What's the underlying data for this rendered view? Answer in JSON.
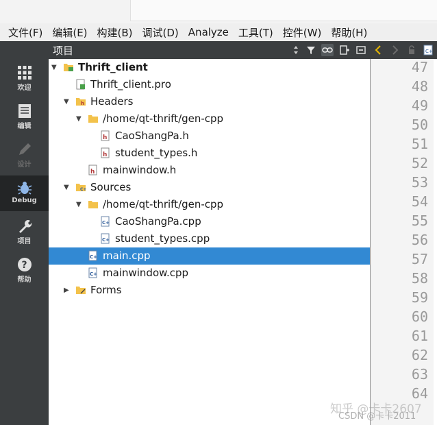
{
  "menubar": [
    "文件(F)",
    "编辑(E)",
    "构建(B)",
    "调试(D)",
    "Analyze",
    "工具(T)",
    "控件(W)",
    "帮助(H)"
  ],
  "modes": [
    {
      "label": "欢迎",
      "icon": "grid-icon"
    },
    {
      "label": "编辑",
      "icon": "document-icon"
    },
    {
      "label": "设计",
      "icon": "pencil-icon"
    },
    {
      "label": "Debug",
      "icon": "bug-icon"
    },
    {
      "label": "项目",
      "icon": "wrench-icon"
    },
    {
      "label": "帮助",
      "icon": "help-icon"
    }
  ],
  "pane": {
    "title": "项目"
  },
  "tree": [
    {
      "label": "Thrift_client",
      "level": 0,
      "arrow": "down",
      "icon": "project-folder-icon",
      "bold": true
    },
    {
      "label": "Thrift_client.pro",
      "level": 1,
      "arrow": "",
      "icon": "pro-file-icon"
    },
    {
      "label": "Headers",
      "level": 1,
      "arrow": "down",
      "icon": "headers-folder-icon"
    },
    {
      "label": "/home/qt-thrift/gen-cpp",
      "level": 2,
      "arrow": "down",
      "icon": "folder-icon"
    },
    {
      "label": "CaoShangPa.h",
      "level": 3,
      "arrow": "",
      "icon": "header-file-icon"
    },
    {
      "label": "student_types.h",
      "level": 3,
      "arrow": "",
      "icon": "header-file-icon"
    },
    {
      "label": "mainwindow.h",
      "level": 2,
      "arrow": "",
      "icon": "header-file-icon"
    },
    {
      "label": "Sources",
      "level": 1,
      "arrow": "down",
      "icon": "sources-folder-icon"
    },
    {
      "label": "/home/qt-thrift/gen-cpp",
      "level": 2,
      "arrow": "down",
      "icon": "folder-icon"
    },
    {
      "label": "CaoShangPa.cpp",
      "level": 3,
      "arrow": "",
      "icon": "cpp-file-icon"
    },
    {
      "label": "student_types.cpp",
      "level": 3,
      "arrow": "",
      "icon": "cpp-file-icon"
    },
    {
      "label": "main.cpp",
      "level": 2,
      "arrow": "",
      "icon": "cpp-file-icon",
      "selected": true
    },
    {
      "label": "mainwindow.cpp",
      "level": 2,
      "arrow": "",
      "icon": "cpp-file-icon"
    },
    {
      "label": "Forms",
      "level": 1,
      "arrow": "right",
      "icon": "forms-folder-icon"
    }
  ],
  "line_numbers": [
    "47",
    "48",
    "49",
    "50",
    "51",
    "52",
    "53",
    "54",
    "55",
    "56",
    "57",
    "58",
    "59",
    "60",
    "61",
    "62",
    "63",
    "64"
  ],
  "watermark": {
    "zhihu": "知乎 @卡卡2607",
    "csdn": "CSDN @卡卡2011"
  },
  "colors": {
    "selection": "#3289d3",
    "sidebar": "#3b3e40",
    "sidebar_active": "#232526"
  }
}
